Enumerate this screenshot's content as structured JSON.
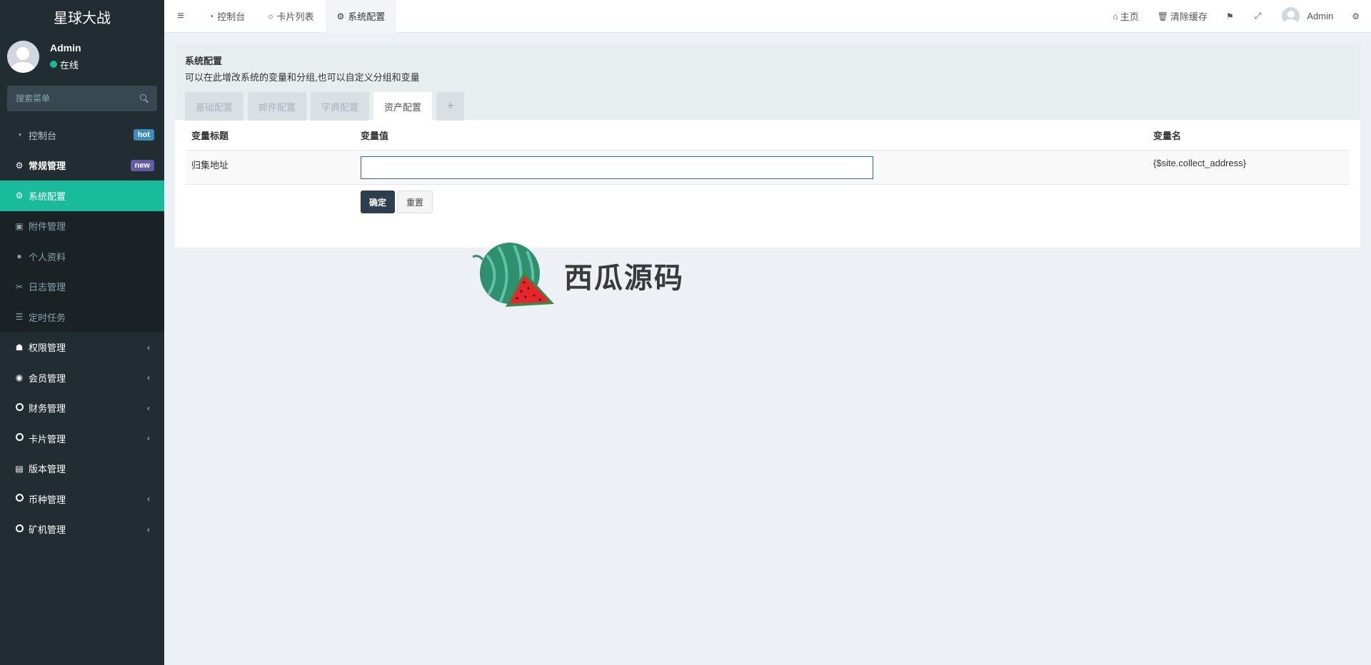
{
  "brand": "星球大战",
  "user": {
    "name": "Admin",
    "status": "在线"
  },
  "search": {
    "placeholder": "搜索菜单"
  },
  "menu": {
    "dashboard": {
      "label": "控制台",
      "badge": "hot"
    },
    "general": {
      "label": "常规管理",
      "badge": "new"
    },
    "sub": {
      "config": "系统配置",
      "attachment": "附件管理",
      "profile": "个人资料",
      "log": "日志管理",
      "cron": "定时任务"
    },
    "auth": "权限管理",
    "member": "会员管理",
    "finance": "财务管理",
    "card": "卡片管理",
    "version": "版本管理",
    "currency": "币种管理",
    "miner": "矿机管理"
  },
  "header": {
    "tabs": [
      "控制台",
      "卡片列表",
      "系统配置"
    ],
    "home": "主页",
    "clear_cache": "清除缓存",
    "admin": "Admin"
  },
  "panel": {
    "title": "系统配置",
    "desc": "可以在此增改系统的变量和分组,也可以自定义分组和变量",
    "tabs": [
      "基础配置",
      "邮件配置",
      "字典配置",
      "资产配置",
      "+"
    ]
  },
  "table": {
    "headers": [
      "变量标题",
      "变量值",
      "变量名"
    ],
    "row": {
      "title": "归集地址",
      "value": "",
      "name": "{$site.collect_address}"
    }
  },
  "buttons": {
    "submit": "确定",
    "reset": "重置"
  },
  "watermark": "西瓜源码",
  "colors": {
    "sidebar": "#222d32",
    "active": "#18bc9c",
    "primary": "#2c3e50"
  }
}
